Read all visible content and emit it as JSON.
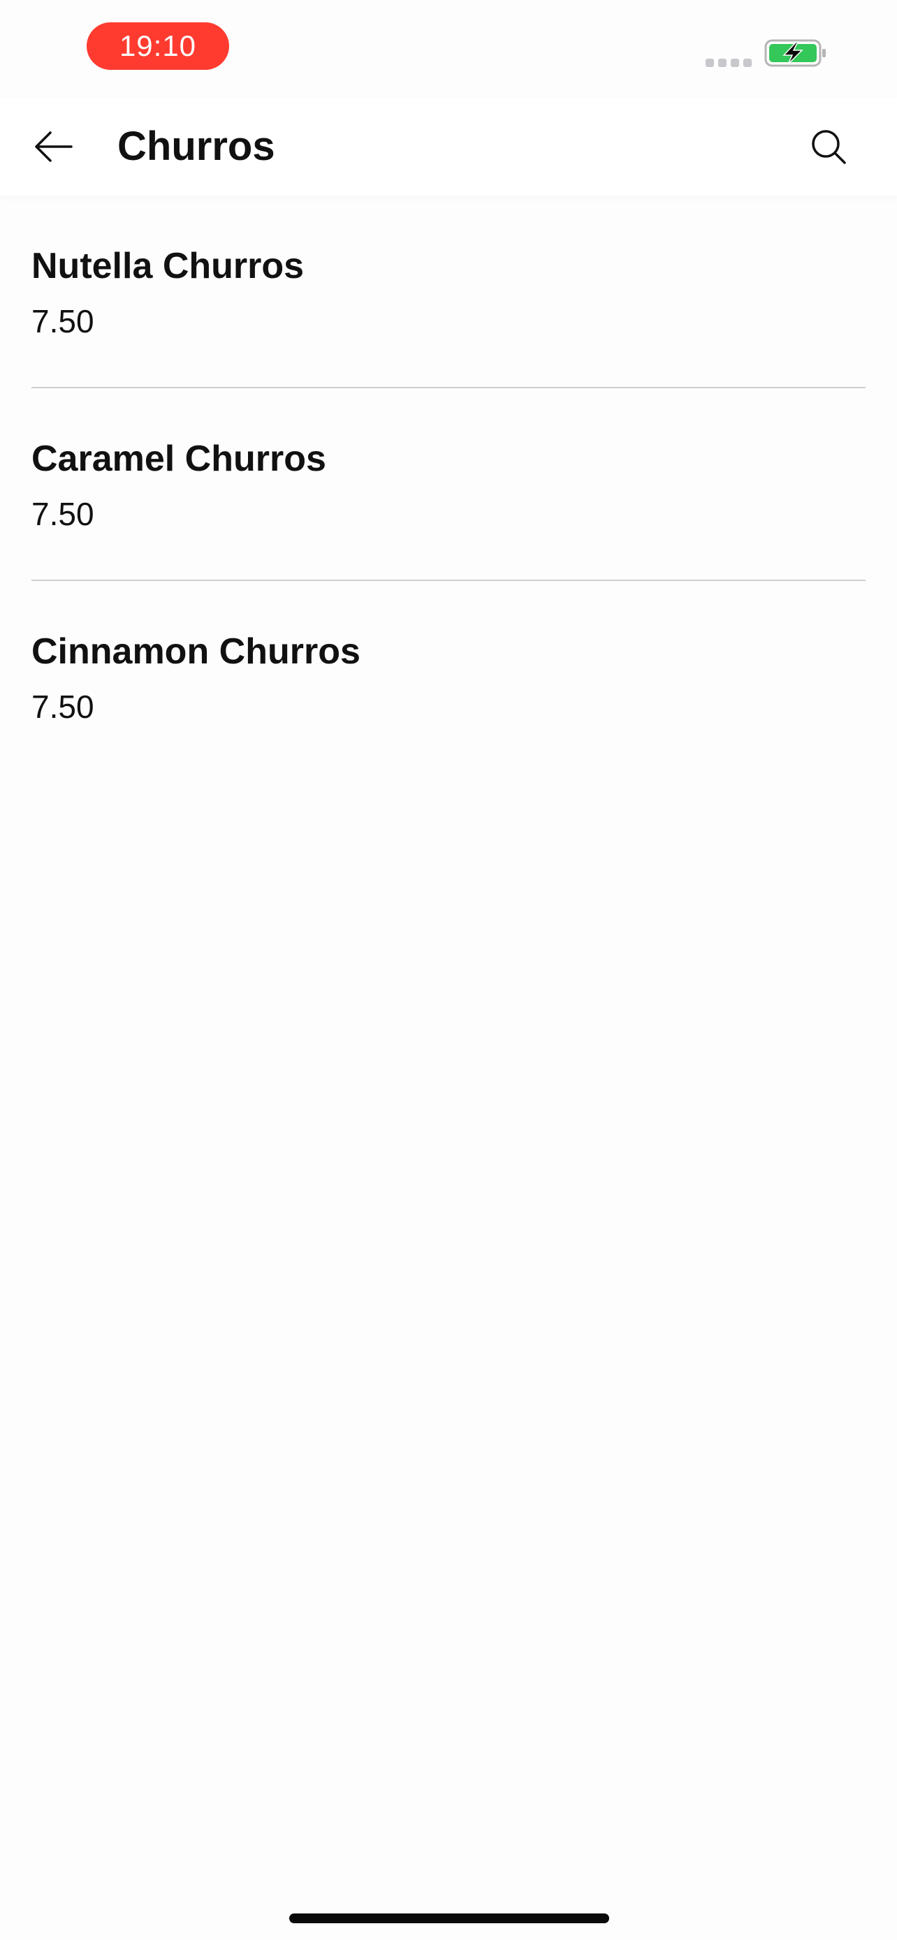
{
  "status_bar": {
    "time": "19:10",
    "time_pill_color": "#ff3b30",
    "battery_color": "#34c759",
    "battery_icon": "battery-charging-icon",
    "signal_icon": "signal-dots-icon"
  },
  "header": {
    "title": "Churros",
    "back_icon": "arrow-left-icon",
    "search_icon": "search-icon"
  },
  "menu": {
    "items": [
      {
        "name": "Nutella Churros",
        "price": "7.50"
      },
      {
        "name": "Caramel Churros",
        "price": "7.50"
      },
      {
        "name": "Cinnamon Churros",
        "price": "7.50"
      }
    ]
  }
}
